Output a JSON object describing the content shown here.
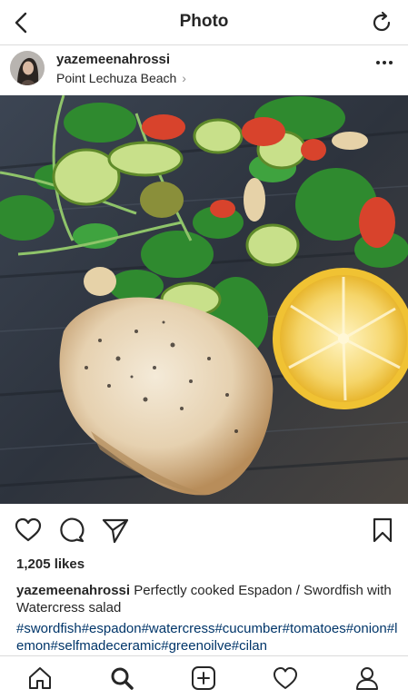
{
  "nav": {
    "title": "Photo",
    "back_icon": "chevron-left-icon",
    "refresh_icon": "refresh-icon"
  },
  "post": {
    "username": "yazemeenahrossi",
    "location": "Point Lechuza Beach",
    "location_chevron": "›",
    "more_icon": "more-dots-icon"
  },
  "actions": {
    "like_icon": "heart-icon",
    "comment_icon": "comment-icon",
    "share_icon": "send-icon",
    "save_icon": "bookmark-icon"
  },
  "likes": "1,205 likes",
  "caption": {
    "username": "yazemeenahrossi",
    "text": "Perfectly cooked Espadon / Swordfish with Watercress salad",
    "hashtags": "#swordfish#espadon#watercress#cucumber#tomatoes#onion#lemon#selfmadeceramic#greenoilve#cilan"
  },
  "tabbar": {
    "items": [
      "home-icon",
      "search-icon",
      "new-post-icon",
      "activity-icon",
      "profile-icon"
    ]
  },
  "colors": {
    "hashtag": "#003569",
    "divider": "#dbdbdb",
    "text": "#262626"
  }
}
